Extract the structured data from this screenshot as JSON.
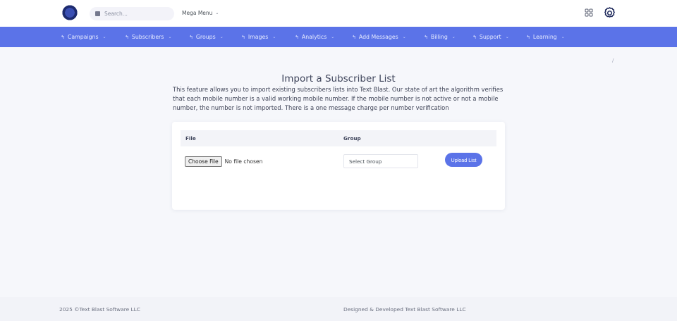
{
  "header": {
    "search_placeholder": "Search...",
    "mega_menu_label": "Mega Menu"
  },
  "nav": {
    "items": [
      {
        "label": "Campaigns"
      },
      {
        "label": "Subscribers"
      },
      {
        "label": "Groups"
      },
      {
        "label": "Images"
      },
      {
        "label": "Analytics"
      },
      {
        "label": "Add Messages"
      },
      {
        "label": "Billing"
      },
      {
        "label": "Support"
      },
      {
        "label": "Learning"
      }
    ]
  },
  "main": {
    "title": "Import a Subscriber List",
    "description": "This feature allows you to import existing subscribers lists into Text Blast. Our state of art the algorithm verifies that each mobile number is a valid working mobile number. If the mobile number is not active or not a mobile number, the number is not imported. There is a one message charge per number verification",
    "breadcrumb_separator": "/",
    "table": {
      "headers": [
        "File",
        "Group"
      ],
      "choose_file_label": "Choose File",
      "no_file_text": "No file chosen",
      "select_group_value": "Select Group",
      "upload_label": "Upload List"
    }
  },
  "footer": {
    "copyright": "2025 ©Text Blast Software LLC",
    "credits": "Designed & Developed Text Blast Software LLC"
  },
  "colors": {
    "accent": "#5b73e8",
    "page_bg": "#f6f7fb",
    "footer_bg": "#f2f3f8"
  },
  "icons": {
    "logo": "logo-icon",
    "search": "search-icon",
    "grid": "apps-grid-icon",
    "settings": "gear-icon",
    "nav_item": "hook-arrow-icon",
    "dropdown": "chevron-down-icon"
  }
}
